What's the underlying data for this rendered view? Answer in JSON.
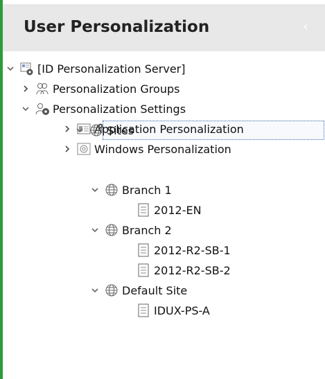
{
  "panel": {
    "title": "User Personalization",
    "collapse_glyph": "‹"
  },
  "tree": {
    "root": {
      "label": "[ID Personalization Server]",
      "icon": "server-settings-icon",
      "expanded": true
    },
    "groups": {
      "label": "Personalization Groups",
      "icon": "user-group-icon",
      "expanded": false
    },
    "settings": {
      "label": "Personalization Settings",
      "icon": "users-settings-icon",
      "expanded": true
    },
    "app": {
      "label": "Application Personalization",
      "icon": "application-icon",
      "expanded": false
    },
    "windows": {
      "label": "Windows Personalization",
      "icon": "windows-settings-icon",
      "expanded": false
    },
    "sites": {
      "label": "Sites",
      "icon": "sites-globe-icon",
      "expanded": true,
      "selected": true
    },
    "branch1": {
      "label": "Branch 1",
      "icon": "globe-icon",
      "expanded": true
    },
    "b1_server1": {
      "label": "2012-EN",
      "icon": "server-document-icon"
    },
    "branch2": {
      "label": "Branch 2",
      "icon": "globe-icon",
      "expanded": true
    },
    "b2_server1": {
      "label": "2012-R2-SB-1",
      "icon": "server-document-icon"
    },
    "b2_server2": {
      "label": "2012-R2-SB-2",
      "icon": "server-document-icon"
    },
    "default_site": {
      "label": "Default Site",
      "icon": "globe-icon",
      "expanded": true
    },
    "ds_server1": {
      "label": "IDUX-PS-A",
      "icon": "server-document-icon"
    }
  },
  "colors": {
    "accent": "#2e9b3a",
    "header_bg": "#e8e8e8",
    "selection_border": "#3a6bb0"
  }
}
